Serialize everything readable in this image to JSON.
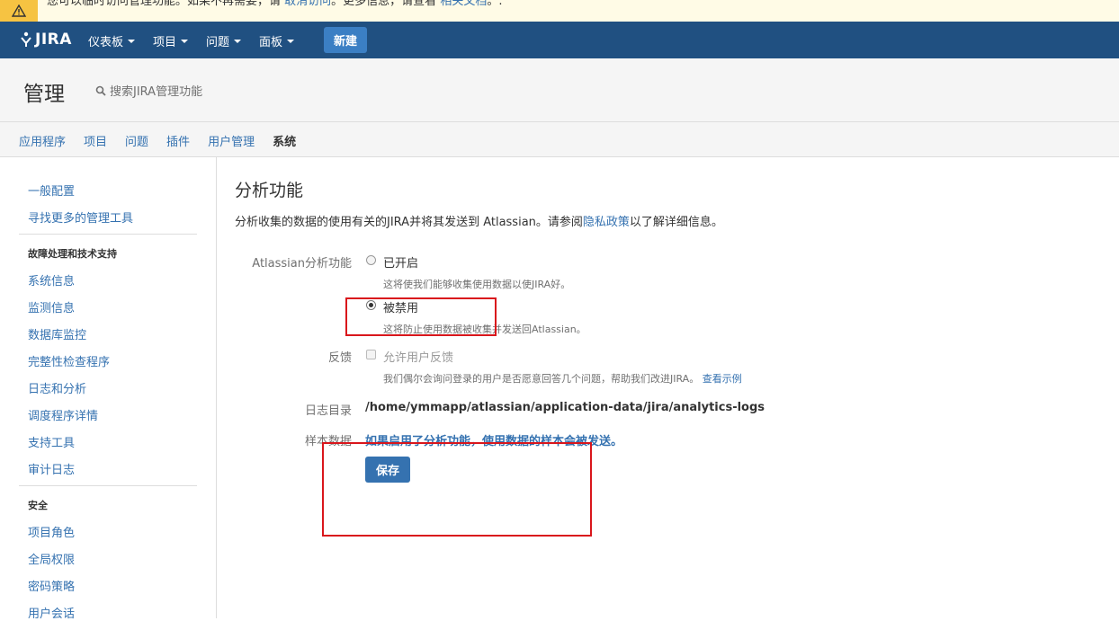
{
  "banner": {
    "text_prefix": "您可以临时访问管理功能。如果不再需要，请",
    "cancel_link": "取消访问",
    "text_mid": "。更多信息，请查看",
    "docs_link": "相关文档",
    "text_suffix": "。."
  },
  "topnav": {
    "logo_text": "JIRA",
    "items": [
      "仪表板",
      "项目",
      "问题",
      "面板"
    ],
    "create_label": "新建"
  },
  "admin": {
    "title": "管理",
    "search_placeholder": "搜索JIRA管理功能"
  },
  "tabs": [
    "应用程序",
    "项目",
    "问题",
    "插件",
    "用户管理",
    "系统"
  ],
  "sidebar": {
    "items_top": [
      "一般配置",
      "寻找更多的管理工具"
    ],
    "section1_title": "故障处理和技术支持",
    "section1_items": [
      "系统信息",
      "监测信息",
      "数据库监控",
      "完整性检查程序",
      "日志和分析",
      "调度程序详情",
      "支持工具",
      "审计日志"
    ],
    "section2_title": "安全",
    "section2_items": [
      "项目角色",
      "全局权限",
      "密码策略",
      "用户会话"
    ]
  },
  "main": {
    "heading": "分析功能",
    "description_prefix": "分析收集的数据的使用有关的JIRA并将其发送到 Atlassian。请参阅",
    "privacy_link": "隐私政策",
    "description_suffix": "以了解详细信息。",
    "analytics_label": "Atlassian分析功能",
    "option_enabled": "已开启",
    "option_enabled_hint": "这将使我们能够收集使用数据以使JIRA好。",
    "option_disabled": "被禁用",
    "option_disabled_hint": "这将防止使用数据被收集并发送回Atlassian。",
    "feedback_label": "反馈",
    "feedback_option": "允许用户反馈",
    "feedback_hint": "我们偶尔会询问登录的用户是否愿意回答几个问题，帮助我们改进JIRA。",
    "feedback_example_link": "查看示例",
    "logdir_label": "日志目录",
    "logdir_value": "/home/ymmapp/atlassian/application-data/jira/analytics-logs",
    "sample_label": "样本数据",
    "sample_link": "如果启用了分析功能，使用数据的样本会被发送。",
    "save_label": "保存"
  },
  "colors": {
    "nav": "#205081",
    "link": "#3572b0",
    "annotation": "#d9161c"
  }
}
